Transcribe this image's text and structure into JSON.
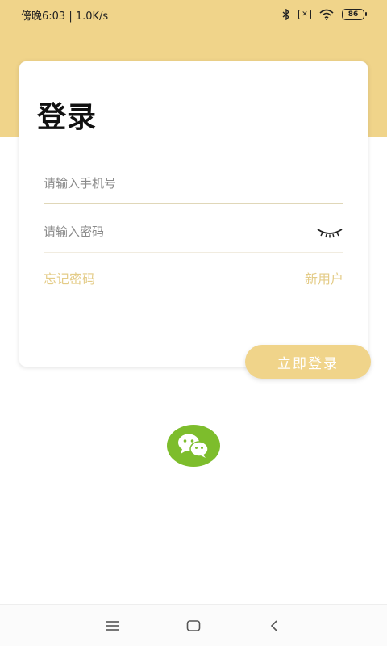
{
  "status_bar": {
    "time_text": "傍晚6:03 | 1.0K/s",
    "battery": "86"
  },
  "login": {
    "title": "登录",
    "phone_placeholder": "请输入手机号",
    "password_placeholder": "请输入密码",
    "forgot_password": "忘记密码",
    "new_user": "新用户",
    "submit_label": "立即登录"
  },
  "icons": {
    "password_toggle": "eye-closed-icon",
    "social_login": "wechat-icon",
    "nav_menu": "menu-icon",
    "nav_home": "home-icon",
    "nav_back": "back-icon"
  },
  "colors": {
    "accent": "#f0d48a",
    "link": "#e4cc88",
    "wechat": "#7dbd2c"
  }
}
